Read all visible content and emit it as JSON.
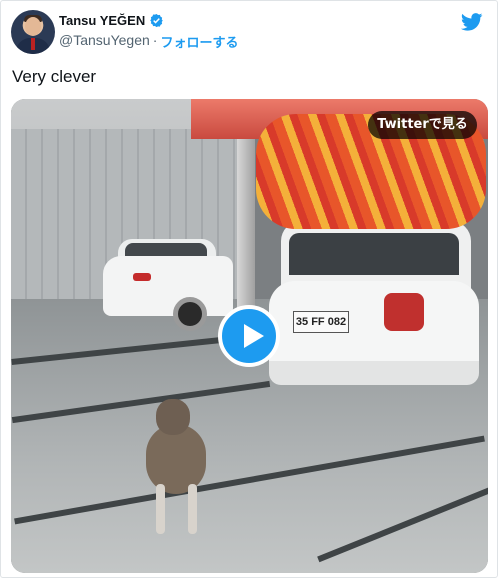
{
  "author": {
    "display_name": "Tansu YEĞEN",
    "handle": "@TansuYegen",
    "separator": "·",
    "follow_label": "フォローする",
    "verified_color": "#1d9bf0"
  },
  "tweet": {
    "text": "Very clever"
  },
  "media": {
    "watch_label": "Twitterで見る",
    "plate_text": "35 FF 082",
    "play_icon": "play-icon"
  },
  "brand": {
    "icon": "twitter-bird-icon",
    "color": "#1d9bf0"
  }
}
